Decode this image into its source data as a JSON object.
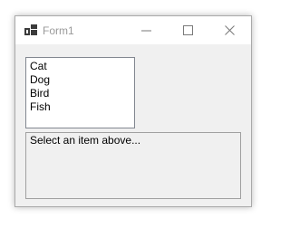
{
  "window": {
    "title": "Form1",
    "icons": {
      "app": "app-windows-form-icon",
      "minimize": "minimize-icon",
      "maximize": "maximize-icon",
      "close": "close-icon"
    }
  },
  "listbox": {
    "items": [
      "Cat",
      "Dog",
      "Bird",
      "Fish"
    ]
  },
  "textbox": {
    "value": "Select an item above..."
  },
  "colors": {
    "titlebar": "#ffffff",
    "client": "#f0f0f0",
    "title_text": "#9a9a9a",
    "list_border": "#828790"
  }
}
